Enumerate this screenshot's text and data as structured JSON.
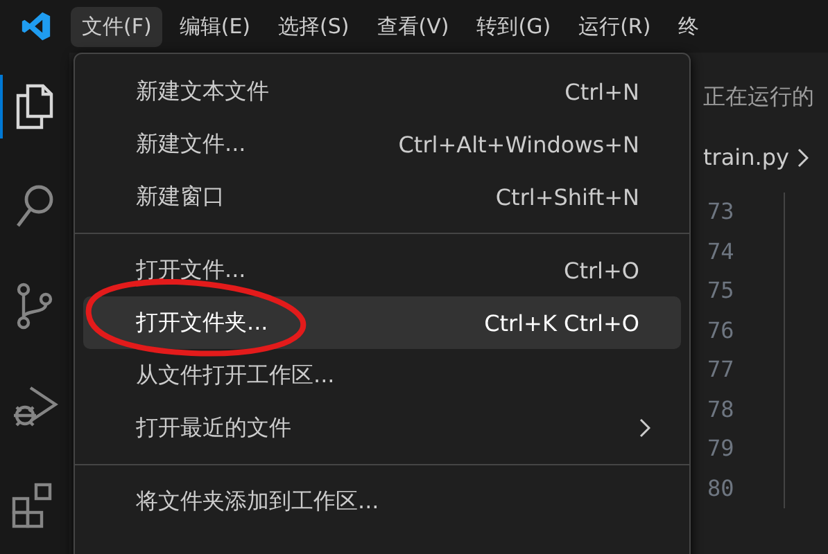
{
  "menubar": [
    {
      "label": "文件(F)",
      "selected": true
    },
    {
      "label": "编辑(E)",
      "selected": false
    },
    {
      "label": "选择(S)",
      "selected": false
    },
    {
      "label": "查看(V)",
      "selected": false
    },
    {
      "label": "转到(G)",
      "selected": false
    },
    {
      "label": "运行(R)",
      "selected": false
    },
    {
      "label": "终",
      "selected": false
    }
  ],
  "activity_bar": [
    {
      "kind": "explorer",
      "selected": true
    },
    {
      "kind": "search",
      "selected": false
    },
    {
      "kind": "source-control",
      "selected": false
    },
    {
      "kind": "run-debug",
      "selected": false
    },
    {
      "kind": "extensions",
      "selected": false
    }
  ],
  "editor": {
    "tab": "正在运行的",
    "breadcrumb": "train.py",
    "line_numbers": [
      "73",
      "74",
      "75",
      "76",
      "77",
      "78",
      "79",
      "80"
    ]
  },
  "file_menu": [
    {
      "kind": "item",
      "label": "新建文本文件",
      "shortcut": "Ctrl+N",
      "selected": false
    },
    {
      "kind": "item",
      "label": "新建文件...",
      "shortcut": "Ctrl+Alt+Windows+N",
      "selected": false
    },
    {
      "kind": "item",
      "label": "新建窗口",
      "shortcut": "Ctrl+Shift+N",
      "selected": false
    },
    {
      "kind": "separator"
    },
    {
      "kind": "item",
      "label": "打开文件...",
      "shortcut": "Ctrl+O",
      "selected": false
    },
    {
      "kind": "item",
      "label": "打开文件夹...",
      "shortcut": "Ctrl+K Ctrl+O",
      "selected": true,
      "circled": true
    },
    {
      "kind": "item",
      "label": "从文件打开工作区...",
      "selected": false
    },
    {
      "kind": "submenu",
      "label": "打开最近的文件",
      "selected": false
    },
    {
      "kind": "separator"
    },
    {
      "kind": "item",
      "label": "将文件夹添加到工作区...",
      "selected": false
    }
  ]
}
